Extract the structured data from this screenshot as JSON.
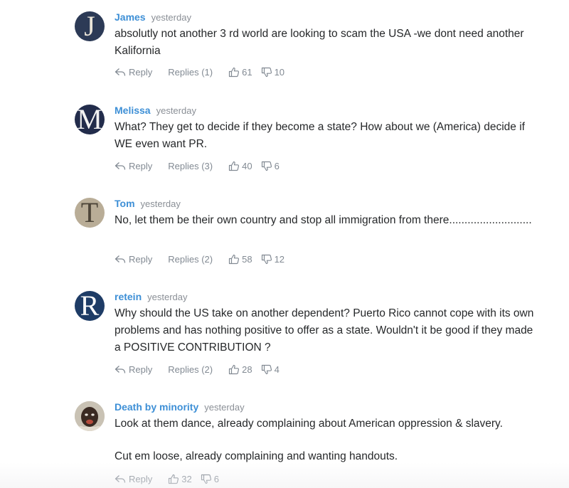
{
  "labels": {
    "reply": "Reply"
  },
  "colors": {
    "name": "#3d8fd6",
    "meta": "#828a93",
    "text": "#26282a"
  },
  "comments": [
    {
      "avatar": {
        "type": "letter",
        "letter": "J",
        "bg": "#2c3a56",
        "fg": "#e9e4d8"
      },
      "name": "James",
      "time": "yesterday",
      "lines": [
        "absolutly not another 3 rd world are looking to scam the USA -we dont need another Kalifornia"
      ],
      "replies": "Replies (1)",
      "up": "61",
      "down": "10"
    },
    {
      "avatar": {
        "type": "letter",
        "letter": "M",
        "bg": "#222c4b",
        "fg": "#f2f2f2"
      },
      "name": "Melissa",
      "time": "yesterday",
      "lines": [
        "What? They get to decide if they become a state? How about we (America) decide if WE even want PR."
      ],
      "replies": "Replies (3)",
      "up": "40",
      "down": "6"
    },
    {
      "avatar": {
        "type": "letter",
        "letter": "T",
        "bg": "#b9ad97",
        "fg": "#4d4538"
      },
      "name": "Tom",
      "time": "yesterday",
      "lines": [
        "No, let them be their own country and stop all immigration from there..........................."
      ],
      "replies": "Replies (2)",
      "up": "58",
      "down": "12"
    },
    {
      "avatar": {
        "type": "letter",
        "letter": "R",
        "bg": "#1e3c66",
        "fg": "#ffffff"
      },
      "name": "retein",
      "time": "yesterday",
      "lines": [
        "Why should the US take on another dependent? Puerto Rico cannot cope with its own problems and has nothing positive to offer as a state. Wouldn't it be good if they made a POSITIVE CONTRIBUTION ?"
      ],
      "replies": "Replies (2)",
      "up": "28",
      "down": "4"
    },
    {
      "avatar": {
        "type": "photo",
        "bg": "#c8c0b0"
      },
      "name": "Death by minority",
      "time": "yesterday",
      "lines": [
        "Look at them dance, already complaining about American oppression & slavery.",
        "Cut em loose, already complaining and wanting handouts."
      ],
      "replies": "",
      "up": "32",
      "down": "6"
    }
  ]
}
